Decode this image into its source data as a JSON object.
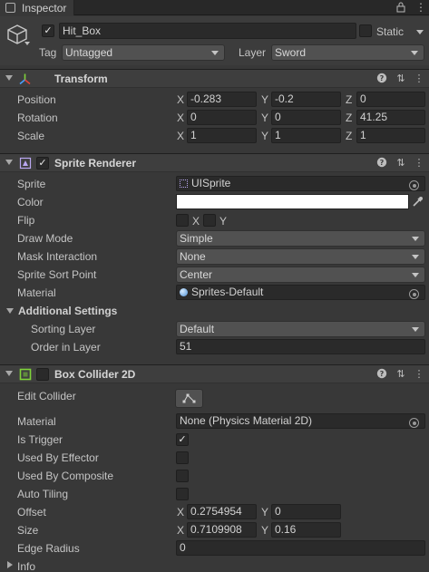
{
  "window": {
    "tab_label": "Inspector"
  },
  "gameobject": {
    "name": "Hit_Box",
    "static_label": "Static",
    "tag_label": "Tag",
    "tag_value": "Untagged",
    "layer_label": "Layer",
    "layer_value": "Sword"
  },
  "transform": {
    "title": "Transform",
    "position": {
      "label": "Position",
      "x": "-0.283",
      "y": "-0.2",
      "z": "0"
    },
    "rotation": {
      "label": "Rotation",
      "x": "0",
      "y": "0",
      "z": "41.25"
    },
    "scale": {
      "label": "Scale",
      "x": "1",
      "y": "1",
      "z": "1"
    }
  },
  "axes": {
    "x": "X",
    "y": "Y",
    "z": "Z"
  },
  "sprite_renderer": {
    "title": "Sprite Renderer",
    "sprite_label": "Sprite",
    "sprite_value": "UISprite",
    "color_label": "Color",
    "color_value": "#ffffff",
    "flip_label": "Flip",
    "flip_x": "X",
    "flip_y": "Y",
    "draw_mode_label": "Draw Mode",
    "draw_mode_value": "Simple",
    "mask_label": "Mask Interaction",
    "mask_value": "None",
    "sort_point_label": "Sprite Sort Point",
    "sort_point_value": "Center",
    "material_label": "Material",
    "material_value": "Sprites-Default",
    "additional_label": "Additional Settings",
    "sorting_layer_label": "Sorting Layer",
    "sorting_layer_value": "Default",
    "order_label": "Order in Layer",
    "order_value": "51"
  },
  "box_collider": {
    "title": "Box Collider 2D",
    "edit_label": "Edit Collider",
    "material_label": "Material",
    "material_value": "None (Physics Material 2D)",
    "is_trigger_label": "Is Trigger",
    "is_trigger": true,
    "effector_label": "Used By Effector",
    "composite_label": "Used By Composite",
    "tiling_label": "Auto Tiling",
    "offset_label": "Offset",
    "offset_x": "0.2754954",
    "offset_y": "0",
    "size_label": "Size",
    "size_x": "0.7109908",
    "size_y": "0.16",
    "edge_label": "Edge Radius",
    "edge_value": "0"
  },
  "info_label": "Info",
  "colors": {
    "background": "#383838",
    "header": "#3e3e3e",
    "field": "#2a2a2a",
    "accent": "#7fd33a"
  }
}
